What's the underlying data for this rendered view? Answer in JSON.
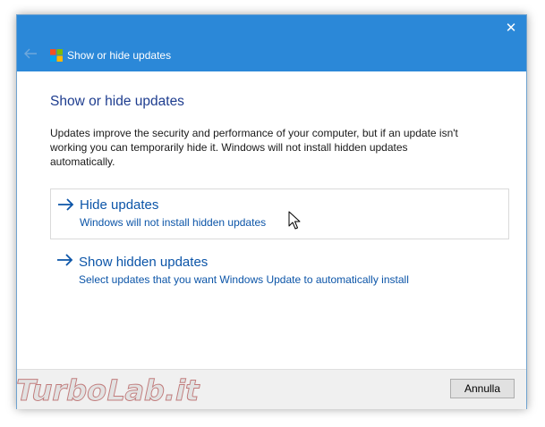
{
  "window": {
    "title": "Show or hide updates",
    "close_symbol": "✕",
    "back_icon": "arrow-left-icon",
    "app_icon": "windows-logo-icon",
    "titlebar_color": "#2b88d8"
  },
  "main": {
    "heading": "Show or hide updates",
    "description": "Updates improve the security and performance of your computer, but if an update isn't working you can temporarily hide it. Windows will not install hidden updates automatically.",
    "options": [
      {
        "title": "Hide updates",
        "subtitle": "Windows will not install hidden updates",
        "icon": "arrow-right-icon",
        "hovered": true
      },
      {
        "title": "Show hidden updates",
        "subtitle": "Select updates that you want Windows Update to automatically install",
        "icon": "arrow-right-icon",
        "hovered": false
      }
    ],
    "link_color": "#0c55a8"
  },
  "footer": {
    "cancel_label": "Annulla"
  },
  "watermark": {
    "text": "TurboLab.it"
  }
}
